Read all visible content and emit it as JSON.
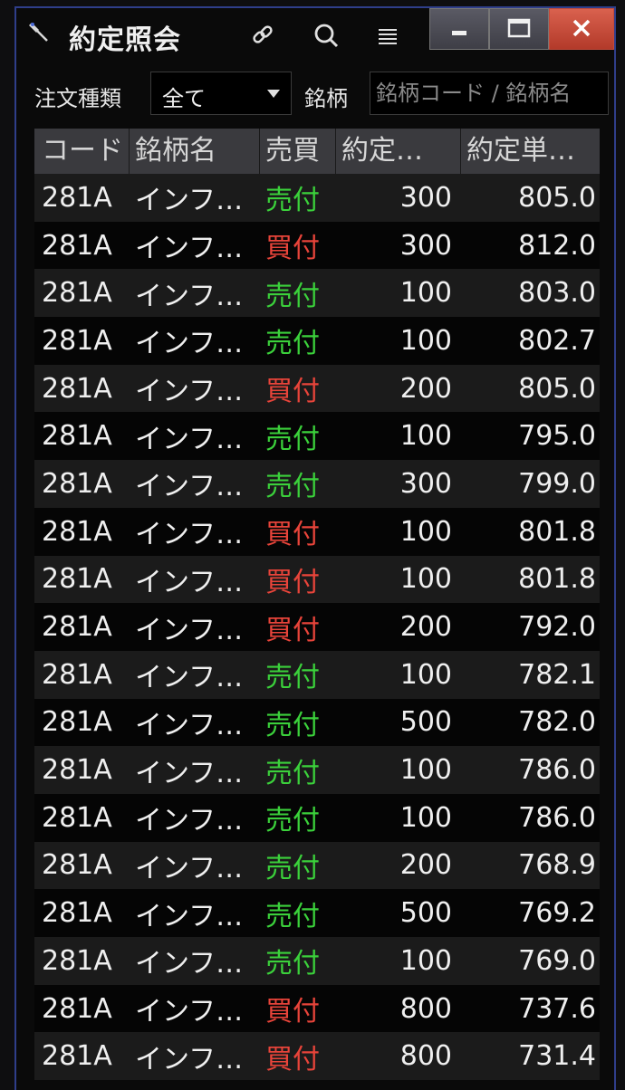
{
  "window": {
    "title": "約定照会"
  },
  "filter": {
    "order_type_label": "注文種類",
    "order_type_value": "全て",
    "stock_label": "銘柄",
    "stock_placeholder": "銘柄コード / 銘柄名"
  },
  "table": {
    "headers": [
      "コード",
      "銘柄名",
      "売買",
      "約定…",
      "約定単…"
    ],
    "rows": [
      {
        "code": "281A",
        "name": "インフ…",
        "side": "売付",
        "type": "sell",
        "qty": "300",
        "price": "805.0"
      },
      {
        "code": "281A",
        "name": "インフ…",
        "side": "買付",
        "type": "buy",
        "qty": "300",
        "price": "812.0"
      },
      {
        "code": "281A",
        "name": "インフ…",
        "side": "売付",
        "type": "sell",
        "qty": "100",
        "price": "803.0"
      },
      {
        "code": "281A",
        "name": "インフ…",
        "side": "売付",
        "type": "sell",
        "qty": "100",
        "price": "802.7"
      },
      {
        "code": "281A",
        "name": "インフ…",
        "side": "買付",
        "type": "buy",
        "qty": "200",
        "price": "805.0"
      },
      {
        "code": "281A",
        "name": "インフ…",
        "side": "売付",
        "type": "sell",
        "qty": "100",
        "price": "795.0"
      },
      {
        "code": "281A",
        "name": "インフ…",
        "side": "売付",
        "type": "sell",
        "qty": "300",
        "price": "799.0"
      },
      {
        "code": "281A",
        "name": "インフ…",
        "side": "買付",
        "type": "buy",
        "qty": "100",
        "price": "801.8"
      },
      {
        "code": "281A",
        "name": "インフ…",
        "side": "買付",
        "type": "buy",
        "qty": "100",
        "price": "801.8"
      },
      {
        "code": "281A",
        "name": "インフ…",
        "side": "買付",
        "type": "buy",
        "qty": "200",
        "price": "792.0"
      },
      {
        "code": "281A",
        "name": "インフ…",
        "side": "売付",
        "type": "sell",
        "qty": "100",
        "price": "782.1"
      },
      {
        "code": "281A",
        "name": "インフ…",
        "side": "売付",
        "type": "sell",
        "qty": "500",
        "price": "782.0"
      },
      {
        "code": "281A",
        "name": "インフ…",
        "side": "売付",
        "type": "sell",
        "qty": "100",
        "price": "786.0"
      },
      {
        "code": "281A",
        "name": "インフ…",
        "side": "売付",
        "type": "sell",
        "qty": "100",
        "price": "786.0"
      },
      {
        "code": "281A",
        "name": "インフ…",
        "side": "売付",
        "type": "sell",
        "qty": "200",
        "price": "768.9"
      },
      {
        "code": "281A",
        "name": "インフ…",
        "side": "売付",
        "type": "sell",
        "qty": "500",
        "price": "769.2"
      },
      {
        "code": "281A",
        "name": "インフ…",
        "side": "売付",
        "type": "sell",
        "qty": "100",
        "price": "769.0"
      },
      {
        "code": "281A",
        "name": "インフ…",
        "side": "買付",
        "type": "buy",
        "qty": "800",
        "price": "737.6"
      },
      {
        "code": "281A",
        "name": "インフ…",
        "side": "買付",
        "type": "buy",
        "qty": "800",
        "price": "731.4"
      }
    ]
  },
  "colors": {
    "sell": "#3bd13b",
    "buy": "#e8443a"
  },
  "icons": {
    "pin": "pin-icon",
    "link": "link-icon",
    "search": "search-icon",
    "menu": "menu-icon",
    "minimize": "minimize-icon",
    "maximize": "maximize-icon",
    "close": "close-icon"
  }
}
